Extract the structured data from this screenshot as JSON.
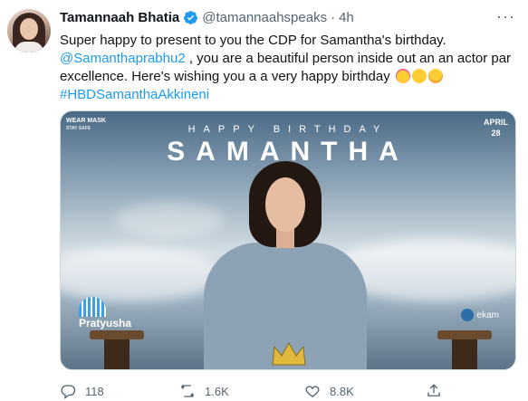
{
  "tweet": {
    "author_name": "Tamannaah Bhatia",
    "handle": "@tamannaahspeaks",
    "separator": "·",
    "time": "4h",
    "more": "···",
    "line1": "Super happy to present to you the CDP for Samantha's birthday.",
    "mention": "@Samanthaprabhu2",
    "line2_rest": " , you are a beautiful person inside out an an actor par",
    "line3": "excellence. Here's wishing you a a very happy birthday",
    "hashtag": "#HBDSamanthaAkkineni"
  },
  "poster": {
    "wear_mask": "WEAR MASK",
    "stay_safe": "STAY SAFE",
    "happy_birthday": "HAPPY BIRTHDAY",
    "name": "SAMANTHA",
    "month": "APRIL",
    "day": "28",
    "logo_left": "Pratyusha",
    "logo_right": "ekam"
  },
  "actions": {
    "replies": "118",
    "retweets": "1.6K",
    "likes": "8.8K"
  },
  "icons": {
    "verified": "verified-badge-icon",
    "reply": "reply-icon",
    "retweet": "retweet-icon",
    "like": "heart-icon",
    "share": "share-icon"
  },
  "colors": {
    "link": "#1d9bf0",
    "muted": "#536471",
    "text": "#0f1419"
  }
}
